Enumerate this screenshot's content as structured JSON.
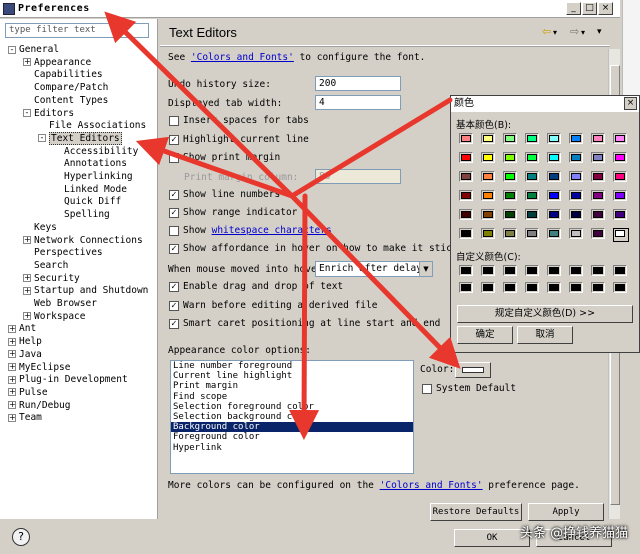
{
  "window": {
    "title": "Preferences"
  },
  "left": {
    "filter_placeholder": "type filter text",
    "tree": [
      {
        "label": "General",
        "level": 0,
        "expander": "-"
      },
      {
        "label": "Appearance",
        "level": 1,
        "expander": "+"
      },
      {
        "label": "Capabilities",
        "level": 1,
        "expander": ""
      },
      {
        "label": "Compare/Patch",
        "level": 1,
        "expander": ""
      },
      {
        "label": "Content Types",
        "level": 1,
        "expander": ""
      },
      {
        "label": "Editors",
        "level": 1,
        "expander": "-"
      },
      {
        "label": "File Associations",
        "level": 2,
        "expander": ""
      },
      {
        "label": "Text Editors",
        "level": 2,
        "expander": "-",
        "selected": true
      },
      {
        "label": "Accessibility",
        "level": 3,
        "expander": ""
      },
      {
        "label": "Annotations",
        "level": 3,
        "expander": ""
      },
      {
        "label": "Hyperlinking",
        "level": 3,
        "expander": ""
      },
      {
        "label": "Linked Mode",
        "level": 3,
        "expander": ""
      },
      {
        "label": "Quick Diff",
        "level": 3,
        "expander": ""
      },
      {
        "label": "Spelling",
        "level": 3,
        "expander": ""
      },
      {
        "label": "Keys",
        "level": 1,
        "expander": ""
      },
      {
        "label": "Network Connections",
        "level": 1,
        "expander": "+"
      },
      {
        "label": "Perspectives",
        "level": 1,
        "expander": ""
      },
      {
        "label": "Search",
        "level": 1,
        "expander": ""
      },
      {
        "label": "Security",
        "level": 1,
        "expander": "+"
      },
      {
        "label": "Startup and Shutdown",
        "level": 1,
        "expander": "+"
      },
      {
        "label": "Web Browser",
        "level": 1,
        "expander": ""
      },
      {
        "label": "Workspace",
        "level": 1,
        "expander": "+"
      },
      {
        "label": "Ant",
        "level": 0,
        "expander": "+"
      },
      {
        "label": "Help",
        "level": 0,
        "expander": "+"
      },
      {
        "label": "Java",
        "level": 0,
        "expander": "+"
      },
      {
        "label": "MyEclipse",
        "level": 0,
        "expander": "+"
      },
      {
        "label": "Plug-in Development",
        "level": 0,
        "expander": "+"
      },
      {
        "label": "Pulse",
        "level": 0,
        "expander": "+"
      },
      {
        "label": "Run/Debug",
        "level": 0,
        "expander": "+"
      },
      {
        "label": "Team",
        "level": 0,
        "expander": "+"
      }
    ]
  },
  "main": {
    "title": "Text Editors",
    "see_prefix": "See ",
    "see_link": "'Colors and Fonts'",
    "see_suffix": " to configure the font.",
    "undo_label": "Undo history size:",
    "undo_value": "200",
    "tab_label": "Displayed tab width:",
    "tab_value": "4",
    "checks": [
      {
        "label": "Insert spaces for tabs",
        "checked": false
      },
      {
        "label": "Highlight current line",
        "checked": true
      },
      {
        "label": "Show print margin",
        "checked": false
      }
    ],
    "print_margin_label": "Print margin column:",
    "print_margin_value": "80",
    "checks2": [
      {
        "label": "Show line numbers",
        "checked": true
      },
      {
        "label": "Show range indicator",
        "checked": true
      }
    ],
    "whitespace_prefix": "Show ",
    "whitespace_link": "whitespace characters",
    "affordance_label": "Show affordance in hover on how to make it sticky",
    "hover_label": "When mouse moved into hover:",
    "hover_value": "Enrich after delay",
    "checks3": [
      {
        "label": "Enable drag and drop of text",
        "checked": true
      },
      {
        "label": "Warn before editing a derived file",
        "checked": true
      },
      {
        "label": "Smart caret positioning at line start and end",
        "checked": true
      }
    ],
    "appearance_label": "Appearance color options:",
    "color_options": [
      "Line number foreground",
      "Current line highlight",
      "Print margin",
      "Find scope",
      "Selection foreground color",
      "Selection background color",
      "Background color",
      "Foreground color",
      "Hyperlink"
    ],
    "selected_option": "Background color",
    "color_label": "Color:",
    "system_default_label": "System Default",
    "more_prefix": "More colors can be configured on the ",
    "more_link": "'Colors and Fonts'",
    "more_suffix": " preference page.",
    "restore_label": "Restore Defaults",
    "apply_label": "Apply",
    "ok_label": "OK",
    "cancel_label": "Cancel"
  },
  "dialog": {
    "title": "颜色",
    "basic_label": "基本颜色(B):",
    "custom_label": "自定义颜色(C):",
    "define_label": "规定自定义颜色(D) >>",
    "ok_label": "确定",
    "cancel_label": "取消",
    "basic_colors": [
      "#ff8080",
      "#ffff80",
      "#80ff80",
      "#00ff80",
      "#80ffff",
      "#0080ff",
      "#ff80c0",
      "#ff80ff",
      "#ff0000",
      "#ffff00",
      "#80ff00",
      "#00ff40",
      "#00ffff",
      "#0080c0",
      "#8080c0",
      "#ff00ff",
      "#804040",
      "#ff8040",
      "#00ff00",
      "#008080",
      "#004080",
      "#8080ff",
      "#800040",
      "#ff0080",
      "#800000",
      "#ff8000",
      "#008000",
      "#008040",
      "#0000ff",
      "#0000a0",
      "#800080",
      "#8000ff",
      "#400000",
      "#804000",
      "#004000",
      "#004040",
      "#000080",
      "#000040",
      "#400040",
      "#400080",
      "#000000",
      "#808000",
      "#808040",
      "#808080",
      "#408080",
      "#c0c0c0",
      "#400040",
      "#ffffff"
    ],
    "custom_colors": [
      "#000000",
      "#000000",
      "#000000",
      "#000000",
      "#000000",
      "#000000",
      "#000000",
      "#000000",
      "#000000",
      "#000000",
      "#000000",
      "#000000",
      "#000000",
      "#000000",
      "#000000",
      "#000000"
    ]
  },
  "watermark": "头条 @挣钱养猫猫",
  "arrow_color": "#e8372c"
}
